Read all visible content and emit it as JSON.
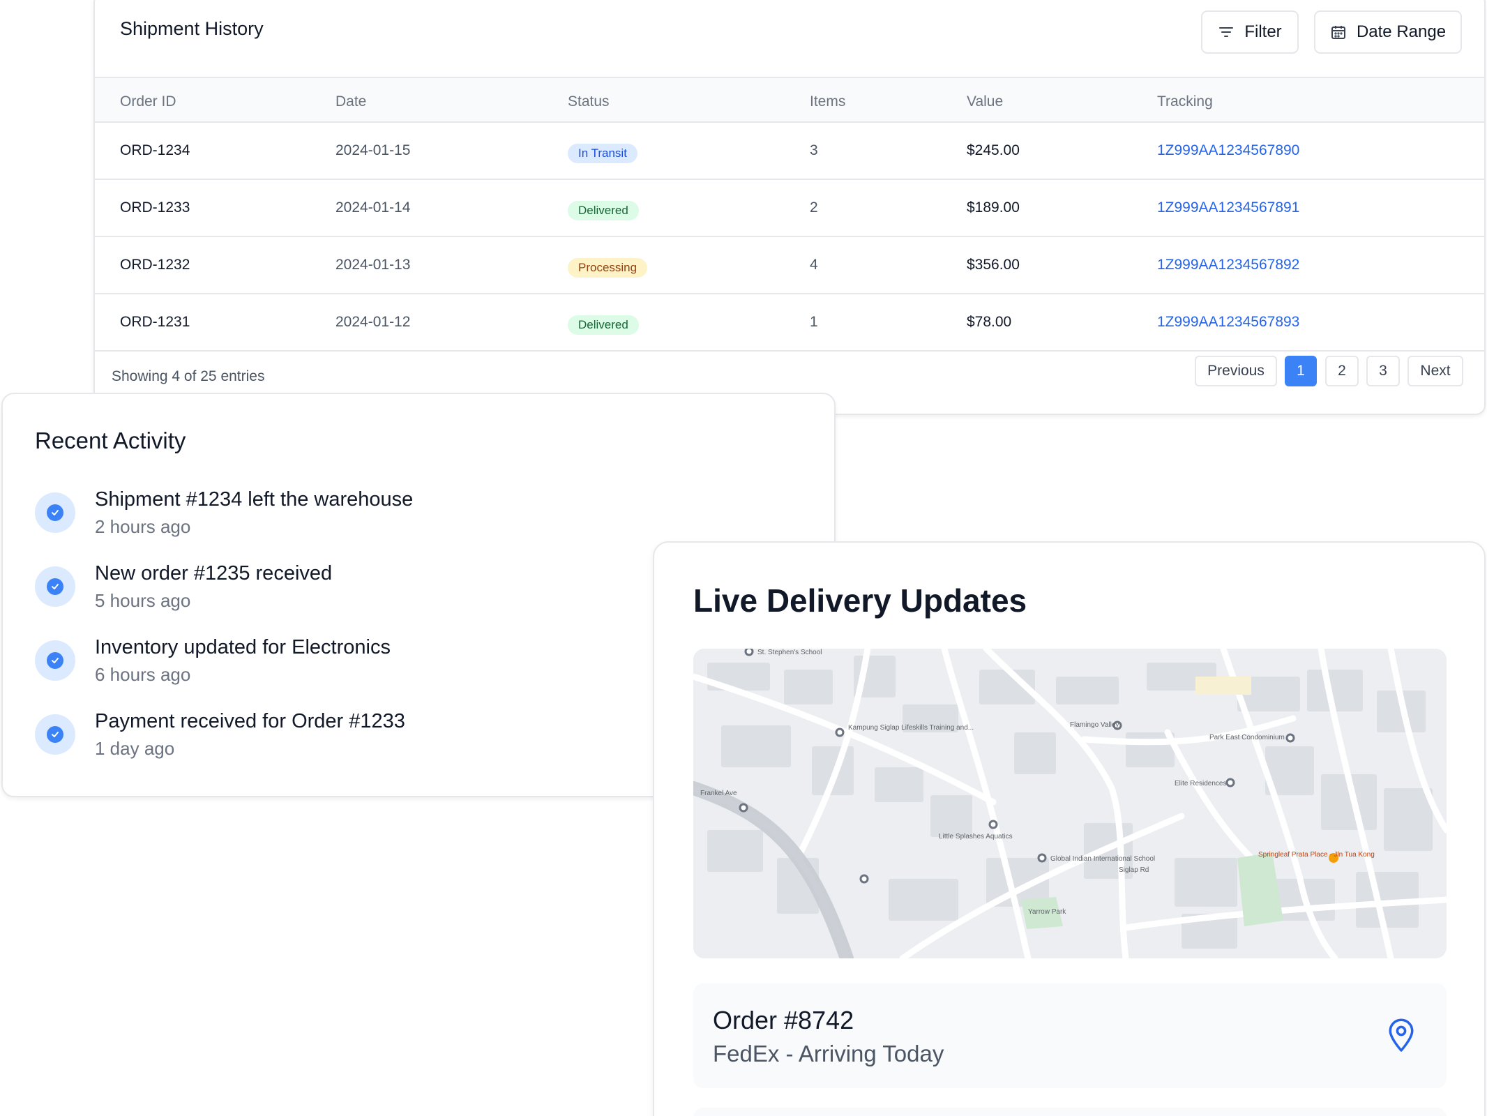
{
  "shipments": {
    "title": "Shipment History",
    "filter_label": "Filter",
    "date_range_label": "Date Range",
    "columns": [
      "Order ID",
      "Date",
      "Status",
      "Items",
      "Value",
      "Tracking"
    ],
    "rows": [
      {
        "id": "ORD-1234",
        "date": "2024-01-15",
        "status": "In Transit",
        "items": "3",
        "value": "$245.00",
        "tracking": "1Z999AA1234567890"
      },
      {
        "id": "ORD-1233",
        "date": "2024-01-14",
        "status": "Delivered",
        "items": "2",
        "value": "$189.00",
        "tracking": "1Z999AA1234567891"
      },
      {
        "id": "ORD-1232",
        "date": "2024-01-13",
        "status": "Processing",
        "items": "4",
        "value": "$356.00",
        "tracking": "1Z999AA1234567892"
      },
      {
        "id": "ORD-1231",
        "date": "2024-01-12",
        "status": "Delivered",
        "items": "1",
        "value": "$78.00",
        "tracking": "1Z999AA1234567893"
      }
    ],
    "showing": "Showing 4 of 25 entries",
    "pagination": {
      "previous": "Previous",
      "pages": [
        "1",
        "2",
        "3"
      ],
      "next": "Next",
      "current": "1"
    }
  },
  "activity": {
    "title": "Recent Activity",
    "items": [
      {
        "text": "Shipment #1234 left the warehouse",
        "time": "2 hours ago"
      },
      {
        "text": "New order #1235 received",
        "time": "5 hours ago"
      },
      {
        "text": "Inventory updated for Electronics",
        "time": "6 hours ago"
      },
      {
        "text": "Payment received for Order #1233",
        "time": "1 day ago"
      }
    ]
  },
  "live": {
    "title": "Live Delivery Updates",
    "map_labels": [
      "St. Stephen's School",
      "Kampung Siglap Lifeskills Training and...",
      "Flamingo Valley",
      "Park East Condominium",
      "Elite Residences",
      "Little Splashes Aquatics",
      "Global Indian International School",
      "Yarrow Park",
      "Siglap Rd",
      "Frankel Ave",
      "Springleaf Prata Place - Jln Tua Kong"
    ],
    "order": {
      "title": "Order #8742",
      "subtitle": "FedEx - Arriving Today"
    }
  },
  "colors": {
    "accent": "#3b82f6",
    "link": "#2563eb",
    "border": "#e5e7eb"
  }
}
